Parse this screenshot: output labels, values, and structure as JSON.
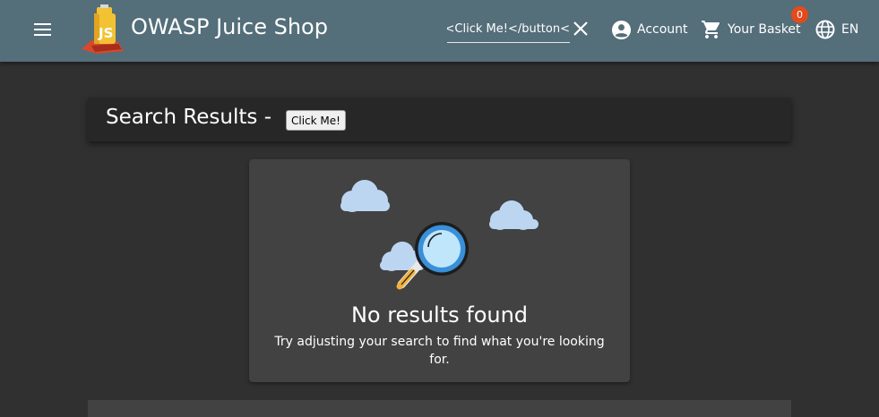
{
  "header": {
    "app_title": "OWASP Juice Shop",
    "menu_icon": "menu-icon",
    "logo": "juice-shop-logo",
    "search": {
      "value": ">Click Me!</button>",
      "clear_icon": "close-icon"
    },
    "account_label": "Account",
    "basket_label": "Your Basket",
    "basket_count": "0",
    "language_label": "EN",
    "background_color": "#546e7a"
  },
  "results": {
    "title": "Search Results -",
    "injected_button_label": "Click Me!"
  },
  "empty_state": {
    "title": "No results found",
    "message": "Try adjusting your search to find what you're looking for."
  }
}
